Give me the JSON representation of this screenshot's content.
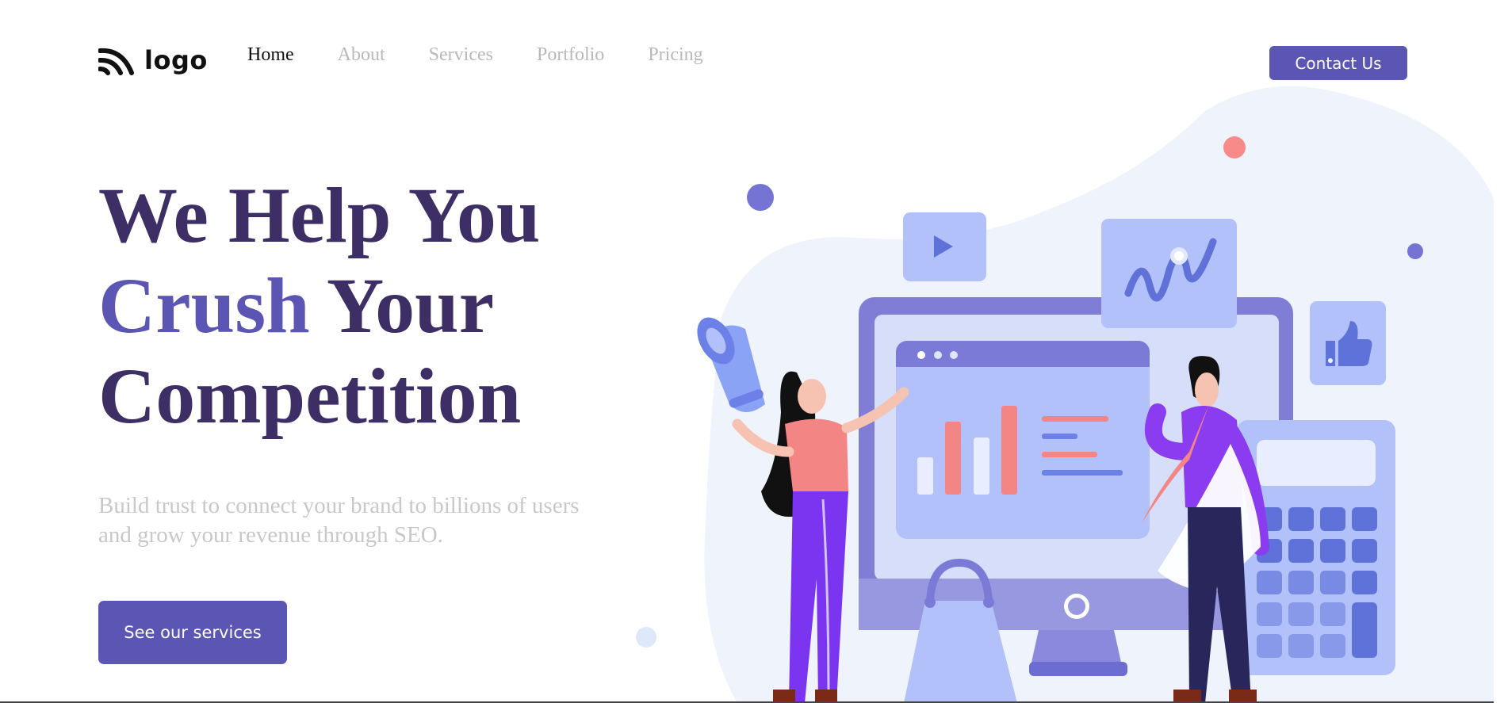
{
  "nav": {
    "logo_text": "logo",
    "links": [
      "Home",
      "About",
      "Services",
      "Portfolio",
      "Pricing"
    ],
    "active": "Home",
    "contact_label": "Contact Us"
  },
  "hero": {
    "title_line1": "We Help You",
    "title_accent": "Crush",
    "title_line2_rest": " Your",
    "title_line3": "Competition",
    "subtitle_line1": "Build trust to connect your brand to billions of users",
    "subtitle_line2": "and grow your revenue through SEO.",
    "cta_label": "See our services"
  },
  "colors": {
    "primary": "#5b55b4",
    "heading": "#3d2e66",
    "muted_text": "#c8c8c8",
    "nav_inactive": "#b9b9b9"
  },
  "icons": [
    "logo-wave-icon",
    "play-icon",
    "thumbs-up-icon",
    "megaphone-icon"
  ]
}
